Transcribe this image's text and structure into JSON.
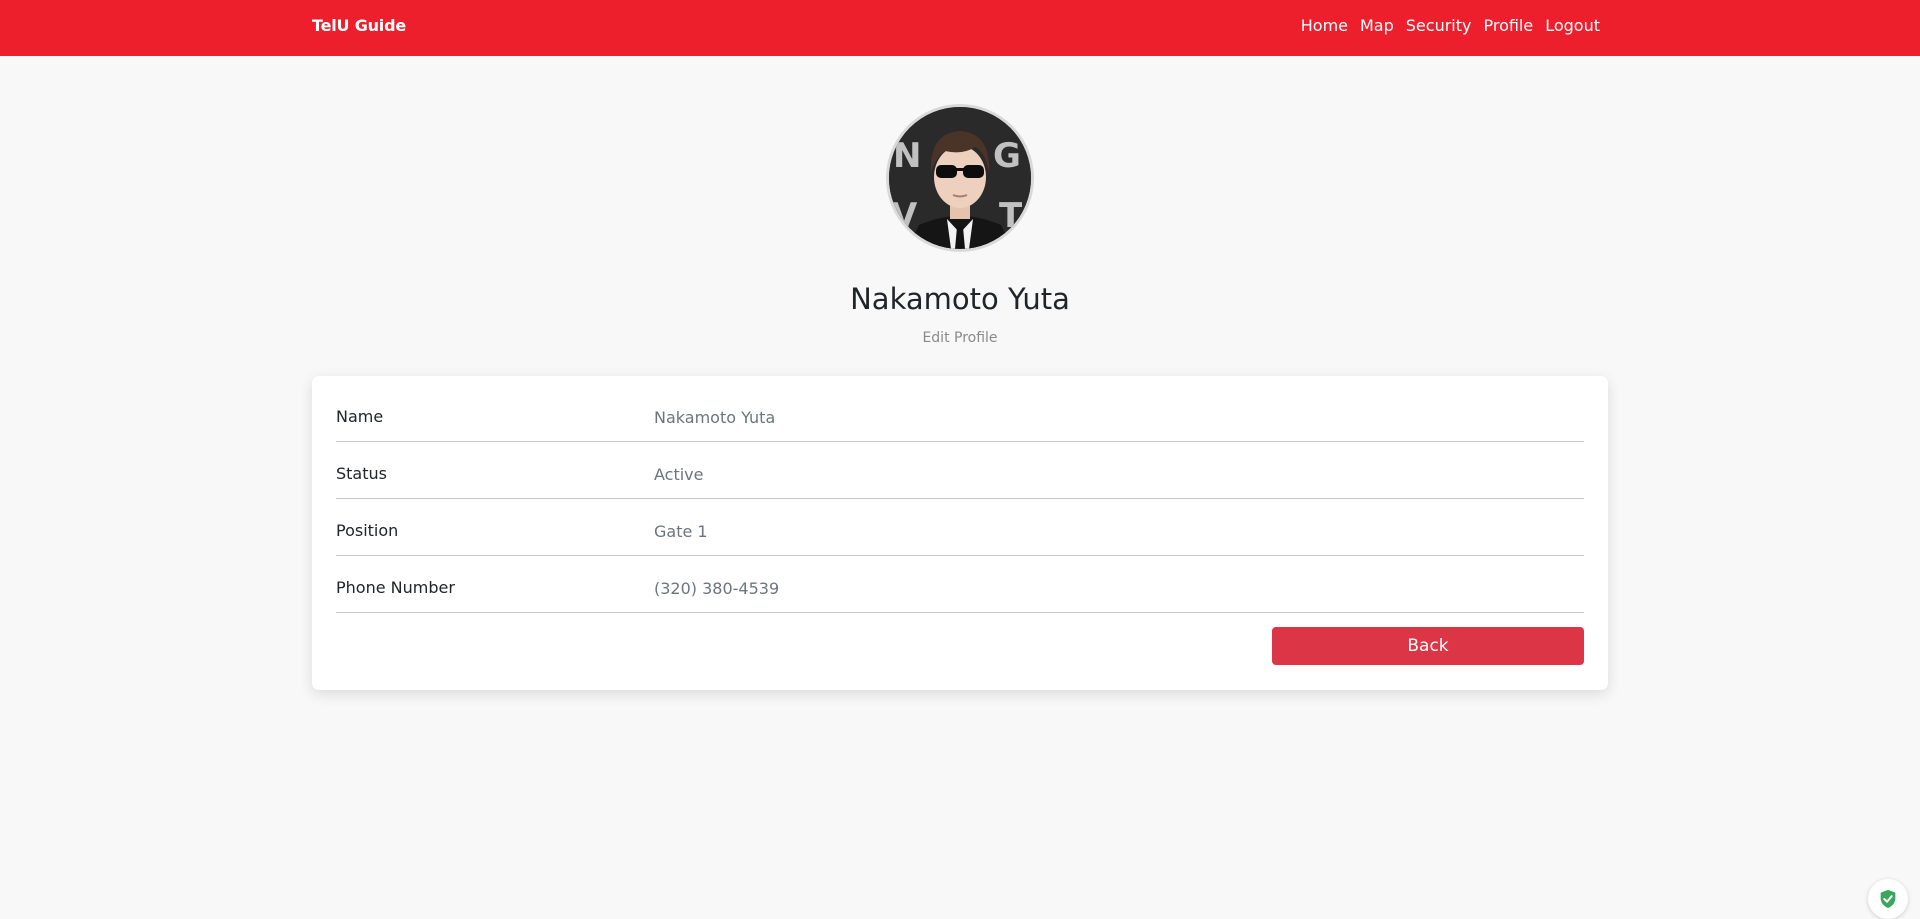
{
  "navbar": {
    "brand": "TelU Guide",
    "links": [
      {
        "label": "Home"
      },
      {
        "label": "Map"
      },
      {
        "label": "Security"
      },
      {
        "label": "Profile"
      },
      {
        "label": "Logout"
      }
    ],
    "color": "#ee1f2d"
  },
  "profile": {
    "name": "Nakamoto Yuta",
    "edit_label": "Edit Profile",
    "avatar_icon": "profile-photo"
  },
  "details": [
    {
      "label": "Name",
      "value": "Nakamoto Yuta"
    },
    {
      "label": "Status",
      "value": "Active"
    },
    {
      "label": "Position",
      "value": "Gate 1"
    },
    {
      "label": "Phone Number",
      "value": "(320) 380-4539"
    }
  ],
  "actions": {
    "back_label": "Back",
    "back_color": "#dc3545"
  },
  "badge": {
    "icon": "shield-check-icon",
    "color": "#3aa65b"
  }
}
